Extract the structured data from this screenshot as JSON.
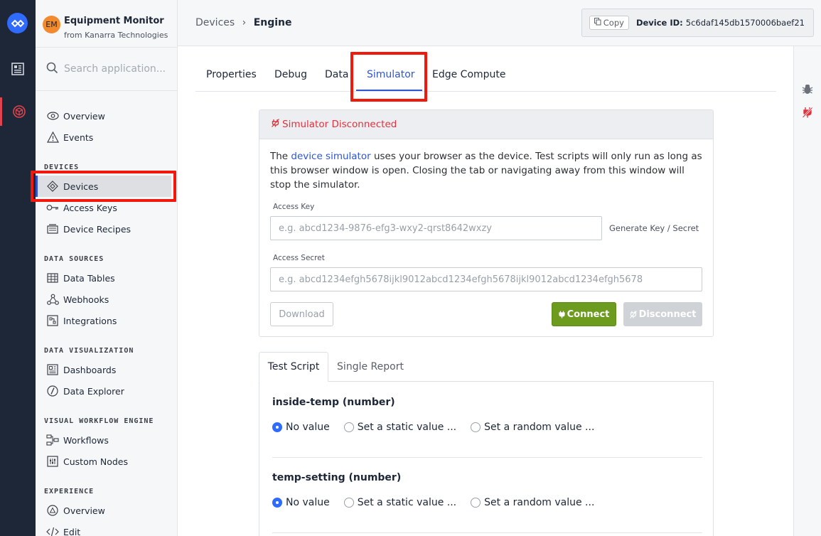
{
  "app": {
    "initials": "EM",
    "name": "Equipment Monitor",
    "org": "from Kanarra Technologies"
  },
  "search": {
    "placeholder": "Search application..."
  },
  "nav": {
    "top": [
      {
        "label": "Overview",
        "icon": "eye-icon"
      },
      {
        "label": "Events",
        "icon": "warning-icon"
      }
    ],
    "sections": [
      {
        "title": "DEVICES",
        "items": [
          {
            "label": "Devices",
            "icon": "device-diamond-icon",
            "selected": true
          },
          {
            "label": "Access Keys",
            "icon": "key-icon"
          },
          {
            "label": "Device Recipes",
            "icon": "recipe-icon"
          }
        ]
      },
      {
        "title": "DATA SOURCES",
        "items": [
          {
            "label": "Data Tables",
            "icon": "table-icon"
          },
          {
            "label": "Webhooks",
            "icon": "webhook-icon"
          },
          {
            "label": "Integrations",
            "icon": "integrations-icon"
          }
        ]
      },
      {
        "title": "DATA VISUALIZATION",
        "items": [
          {
            "label": "Dashboards",
            "icon": "dashboard-icon"
          },
          {
            "label": "Data Explorer",
            "icon": "compass-icon"
          }
        ]
      },
      {
        "title": "VISUAL WORKFLOW ENGINE",
        "items": [
          {
            "label": "Workflows",
            "icon": "workflow-icon"
          },
          {
            "label": "Custom Nodes",
            "icon": "custom-nodes-icon"
          }
        ]
      },
      {
        "title": "EXPERIENCE",
        "items": [
          {
            "label": "Overview",
            "icon": "experience-overview-icon"
          },
          {
            "label": "Edit",
            "icon": "code-icon"
          }
        ]
      }
    ]
  },
  "breadcrumb": {
    "parent": "Devices",
    "separator": "›",
    "current": "Engine"
  },
  "device_id": {
    "copy_label": "Copy",
    "label": "Device ID:",
    "value": "5c6daf145db1570006baef21"
  },
  "tabs": [
    {
      "label": "Properties",
      "active": false
    },
    {
      "label": "Debug",
      "active": false
    },
    {
      "label": "Data",
      "active": false
    },
    {
      "label": "Simulator",
      "active": true
    },
    {
      "label": "Edge Compute",
      "active": false
    }
  ],
  "simulator": {
    "status": "Simulator Disconnected",
    "desc_pre": "The ",
    "desc_link": "device simulator",
    "desc_post": " uses your browser as the device. Test scripts will only run as long as this browser window is open. Closing the tab or navigating away from this window will stop the simulator.",
    "access_key_label": "Access Key",
    "access_key_placeholder": "e.g. abcd1234-9876-efg3-wxy2-qrst8642wxzy",
    "generate_label": "Generate Key / Secret",
    "access_secret_label": "Access Secret",
    "access_secret_placeholder": "e.g. abcd1234efgh5678ijkl9012abcd1234efgh5678ijkl9012abcd1234efgh5678",
    "download_label": "Download",
    "connect_label": "Connect",
    "disconnect_label": "Disconnect"
  },
  "script_tabs": [
    {
      "label": "Test Script",
      "active": true
    },
    {
      "label": "Single Report",
      "active": false
    }
  ],
  "fields": [
    {
      "name": "inside-temp (number)",
      "options": [
        "No value",
        "Set a static value ...",
        "Set a random value ..."
      ],
      "selected": 0
    },
    {
      "name": "temp-setting (number)",
      "options": [
        "No value",
        "Set a static value ...",
        "Set a random value ..."
      ],
      "selected": 0
    }
  ],
  "colors": {
    "accent": "#2f55d4",
    "danger": "#e0323d",
    "connect": "#6c9b1e",
    "highlight": "#f0190c",
    "rail": "#1d2737"
  }
}
